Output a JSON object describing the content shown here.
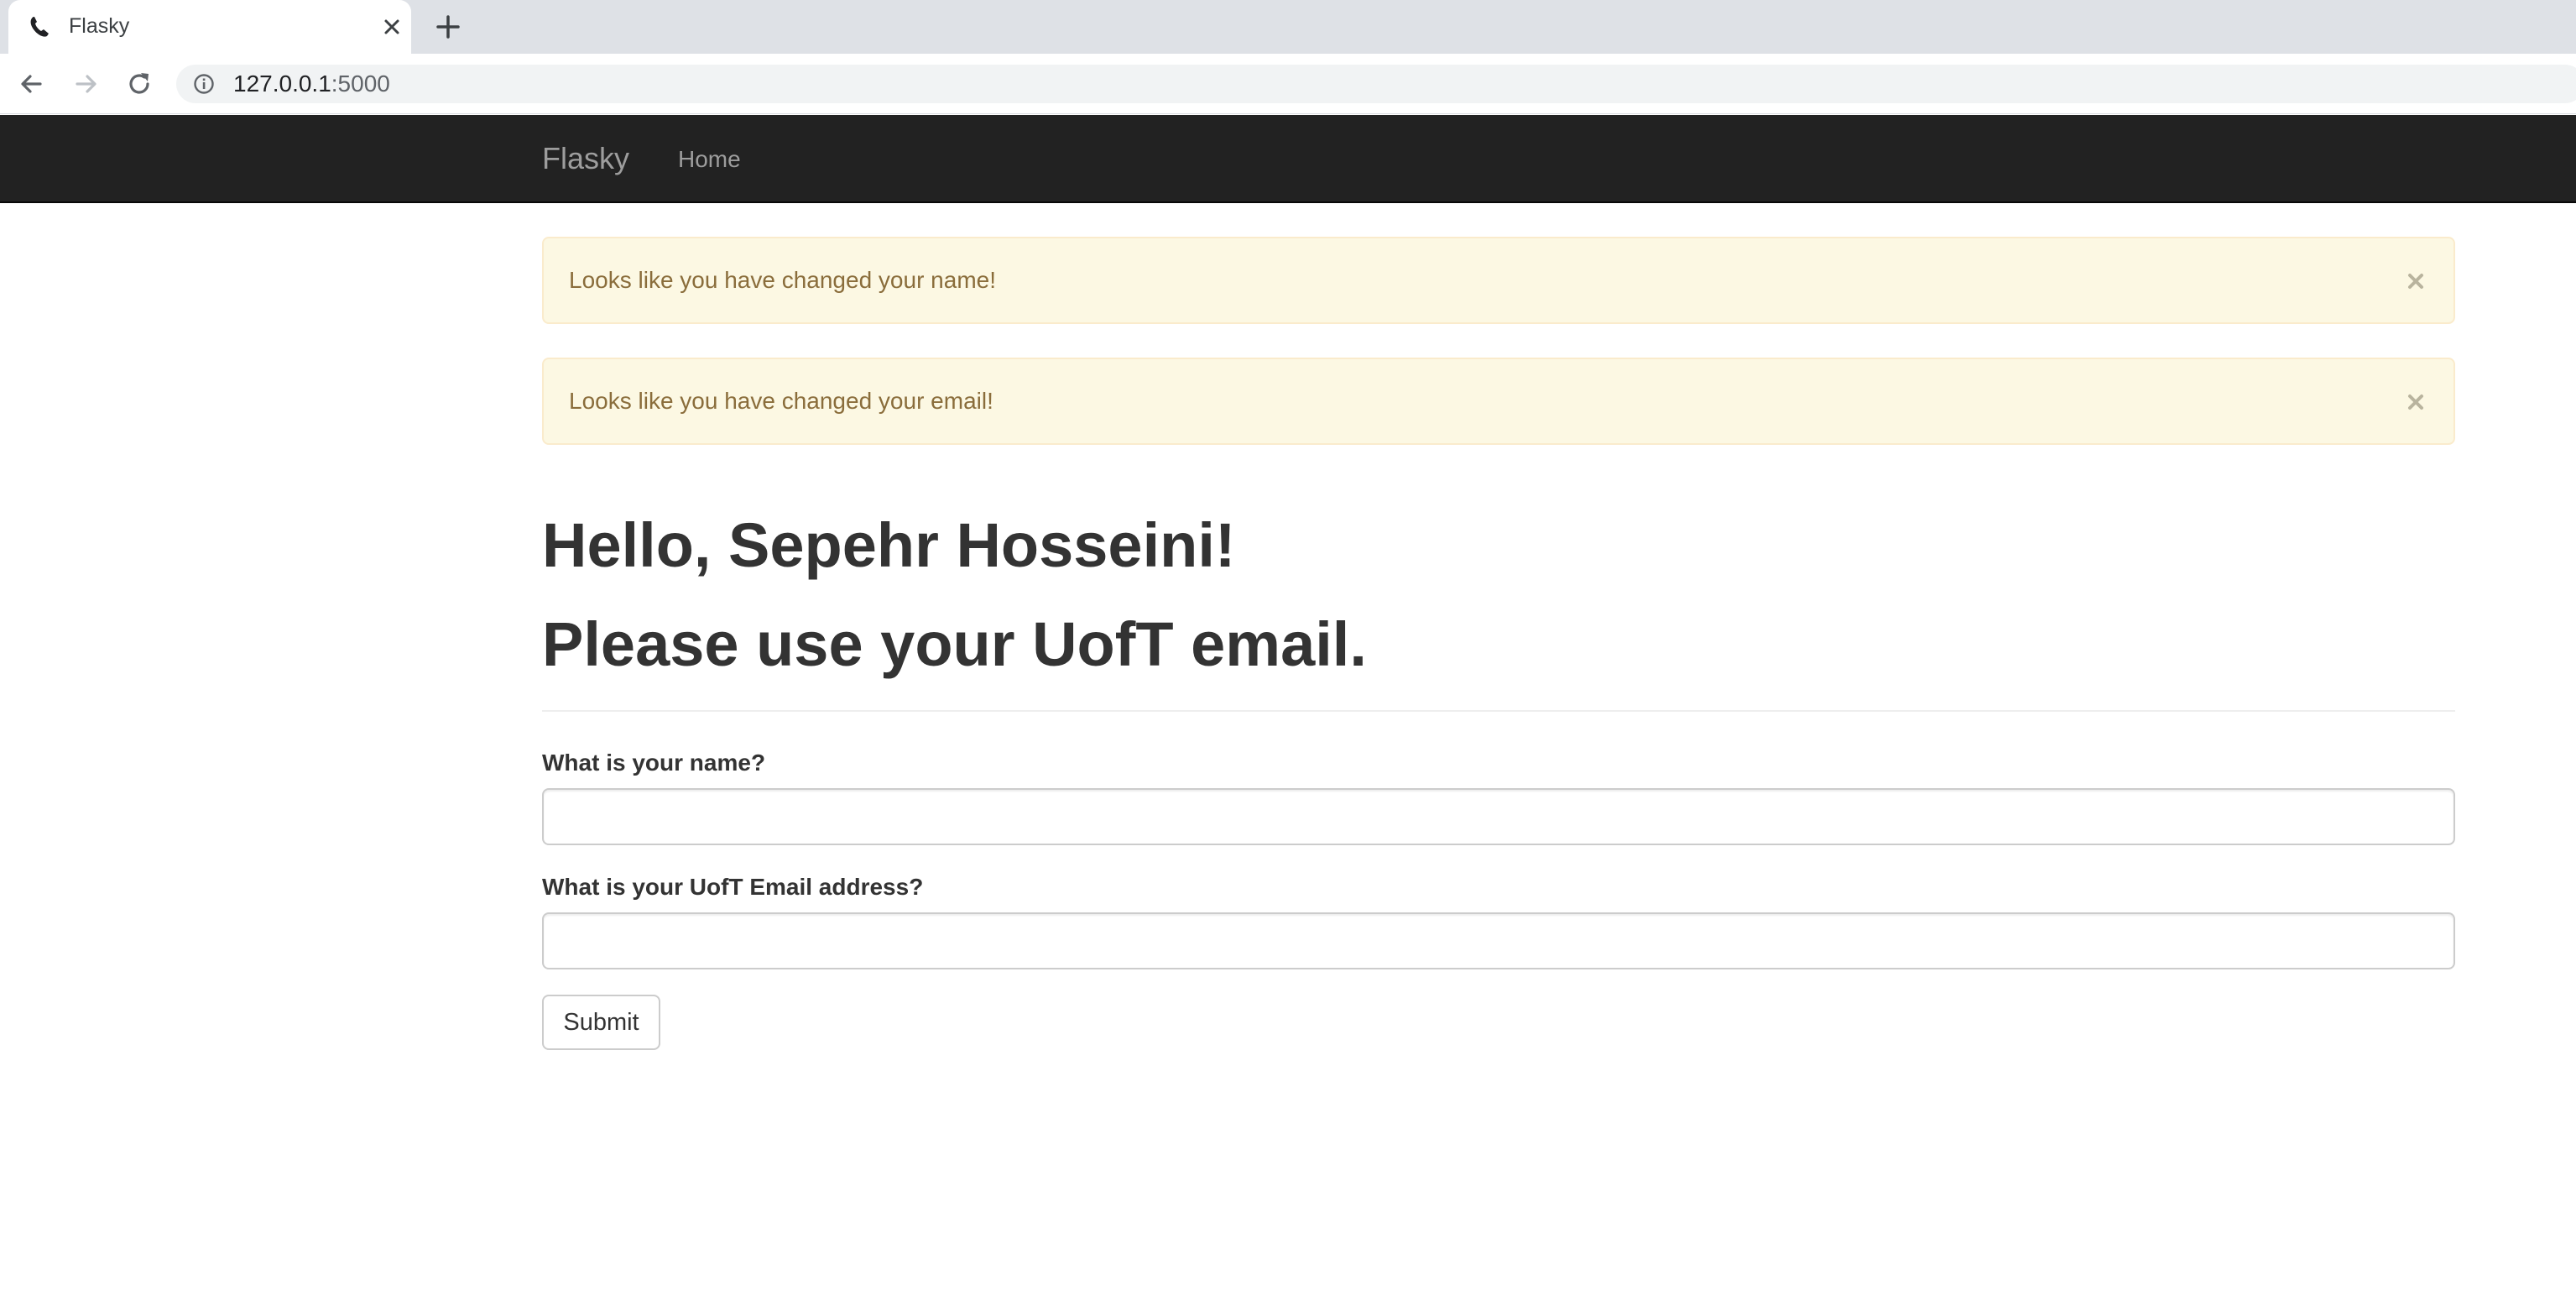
{
  "browser": {
    "tab_title": "Flasky",
    "url_host": "127.0.0.1",
    "url_port": ":5000",
    "icons": {
      "favicon": "phone-icon",
      "tab_close": "close-icon",
      "new_tab": "plus-icon",
      "back": "arrow-left-icon",
      "forward": "arrow-right-icon",
      "reload": "reload-icon",
      "site_info": "info-icon"
    }
  },
  "navbar": {
    "brand": "Flasky",
    "links": [
      "Home"
    ]
  },
  "alerts": [
    {
      "text": "Looks like you have changed your name!"
    },
    {
      "text": "Looks like you have changed your email!"
    }
  ],
  "page": {
    "greeting": "Hello, Sepehr Hosseini!",
    "notice": "Please use your UofT email."
  },
  "form": {
    "name_label": "What is your name?",
    "name_value": "",
    "email_label": "What is your UofT Email address?",
    "email_value": "",
    "submit_label": "Submit"
  },
  "colors": {
    "navbar_bg": "#222222",
    "alert_bg": "#fcf8e3",
    "alert_border": "#faebcc",
    "alert_text": "#8a6d3b"
  }
}
